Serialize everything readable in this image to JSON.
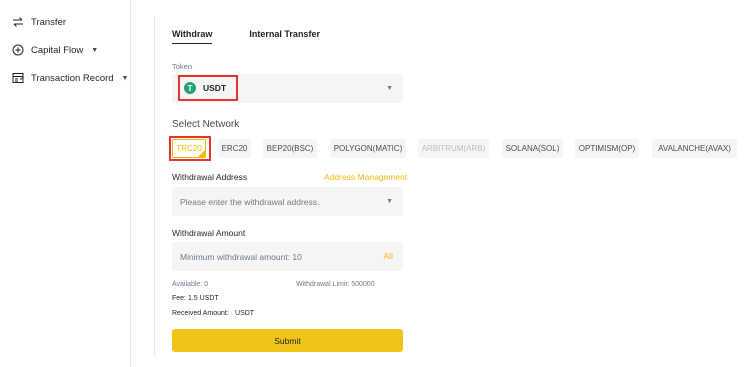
{
  "sidebar": {
    "items": [
      {
        "label": "Transfer",
        "icon": "transfer-icon",
        "has_caret": false
      },
      {
        "label": "Capital Flow",
        "icon": "plus-circle-icon",
        "has_caret": true
      },
      {
        "label": "Transaction Record",
        "icon": "record-icon",
        "has_caret": true
      }
    ]
  },
  "tabs": [
    {
      "label": "Withdraw",
      "active": true
    },
    {
      "label": "Internal Transfer",
      "active": false
    }
  ],
  "token": {
    "label": "Token",
    "selected": "USDT",
    "logo_letter": "T",
    "logo_color": "#26a17b"
  },
  "network": {
    "title": "Select Network",
    "options": [
      {
        "label": "TRC20",
        "selected": true,
        "disabled": false
      },
      {
        "label": "ERC20",
        "selected": false,
        "disabled": false
      },
      {
        "label": "BEP20(BSC)",
        "selected": false,
        "disabled": false
      },
      {
        "label": "POLYGON(MATIC)",
        "selected": false,
        "disabled": false
      },
      {
        "label": "ARBITRUM(ARB)",
        "selected": false,
        "disabled": true
      },
      {
        "label": "SOLANA(SOL)",
        "selected": false,
        "disabled": false
      },
      {
        "label": "OPTIMISM(OP)",
        "selected": false,
        "disabled": false
      },
      {
        "label": "AVALANCHE(AVAX)",
        "selected": false,
        "disabled": false
      }
    ]
  },
  "withdrawal_address": {
    "label": "Withdrawal Address",
    "link": "Address Management",
    "placeholder": "Please enter the withdrawal address."
  },
  "withdrawal_amount": {
    "label": "Withdrawal Amount",
    "placeholder": "Minimum withdrawal amount: 10",
    "all_label": "All"
  },
  "info": {
    "available": "Available: 0",
    "limit": "Withdrawal Limit: 500000",
    "fee": "Fee: 1.5 USDT",
    "received": "Received Amount:  · USDT"
  },
  "submit_label": "Submit",
  "colors": {
    "accent": "#f0b90b",
    "button": "#f0c419",
    "highlight": "#e8322e"
  }
}
